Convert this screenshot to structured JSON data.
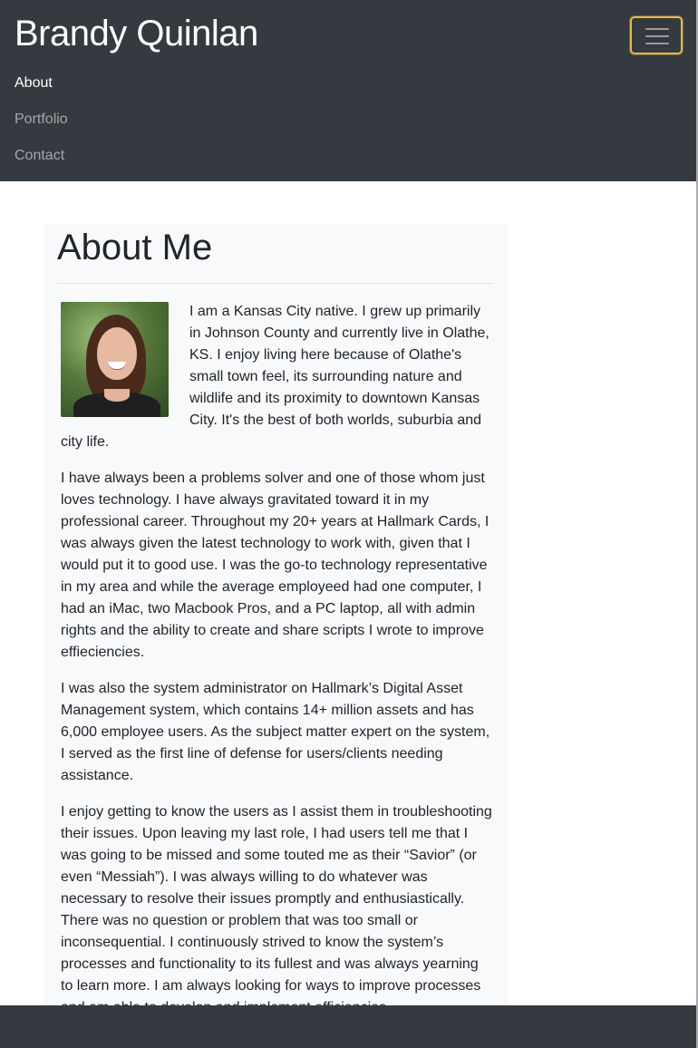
{
  "navbar": {
    "brand": "Brandy Quinlan",
    "toggler_icon": "hamburger-menu-icon",
    "items": [
      {
        "label": "About",
        "active": true
      },
      {
        "label": "Portfolio",
        "active": false
      },
      {
        "label": "Contact",
        "active": false
      }
    ]
  },
  "main": {
    "title": "About Me",
    "paragraphs": [
      "I am a Kansas City native. I grew up primarily in Johnson County and currently live in Olathe, KS. I enjoy living here because of Olathe's small town feel, its surrounding nature and wildlife and its proximity to downtown Kansas City. It's the best of both worlds, suburbia and city life.",
      "I have always been a problems solver and one of those whom just loves technology. I have always gravitated toward it in my professional career. Throughout my 20+ years at Hallmark Cards, I was always given the latest technology to work with, given that I would put it to good use. I was the go-to technology representative in my area and while the average employeed had one computer, I had an iMac, two Macbook Pros, and a PC laptop, all with admin rights and the ability to create and share scripts I wrote to improve effieciencies.",
      "I was also the system administrator on Hallmark’s Digital Asset Management system, which contains 14+ million assets and has 6,000 employee users. As the subject matter expert on the system, I served as the first line of defense for users/clients needing assistance.",
      "I enjoy getting to know the users as I assist them in troubleshooting their issues. Upon leaving my last role, I had users tell me that I was going to be missed and some touted me as their “Savior” (or even “Messiah”). I was always willing to do whatever was necessary to resolve their issues promptly and enthusiastically. There was no question or problem that was too small or inconsequential. I continuously strived to know the system’s processes and functionality to its fullest and was always yearning to learn more. I am always looking for ways to improve processes and am able to develop and implement efficiencies."
    ]
  },
  "colors": {
    "navbar_bg": "#343a40",
    "card_bg": "#f8f9fa",
    "text": "#212529",
    "focus_ring": "#e7b844"
  }
}
